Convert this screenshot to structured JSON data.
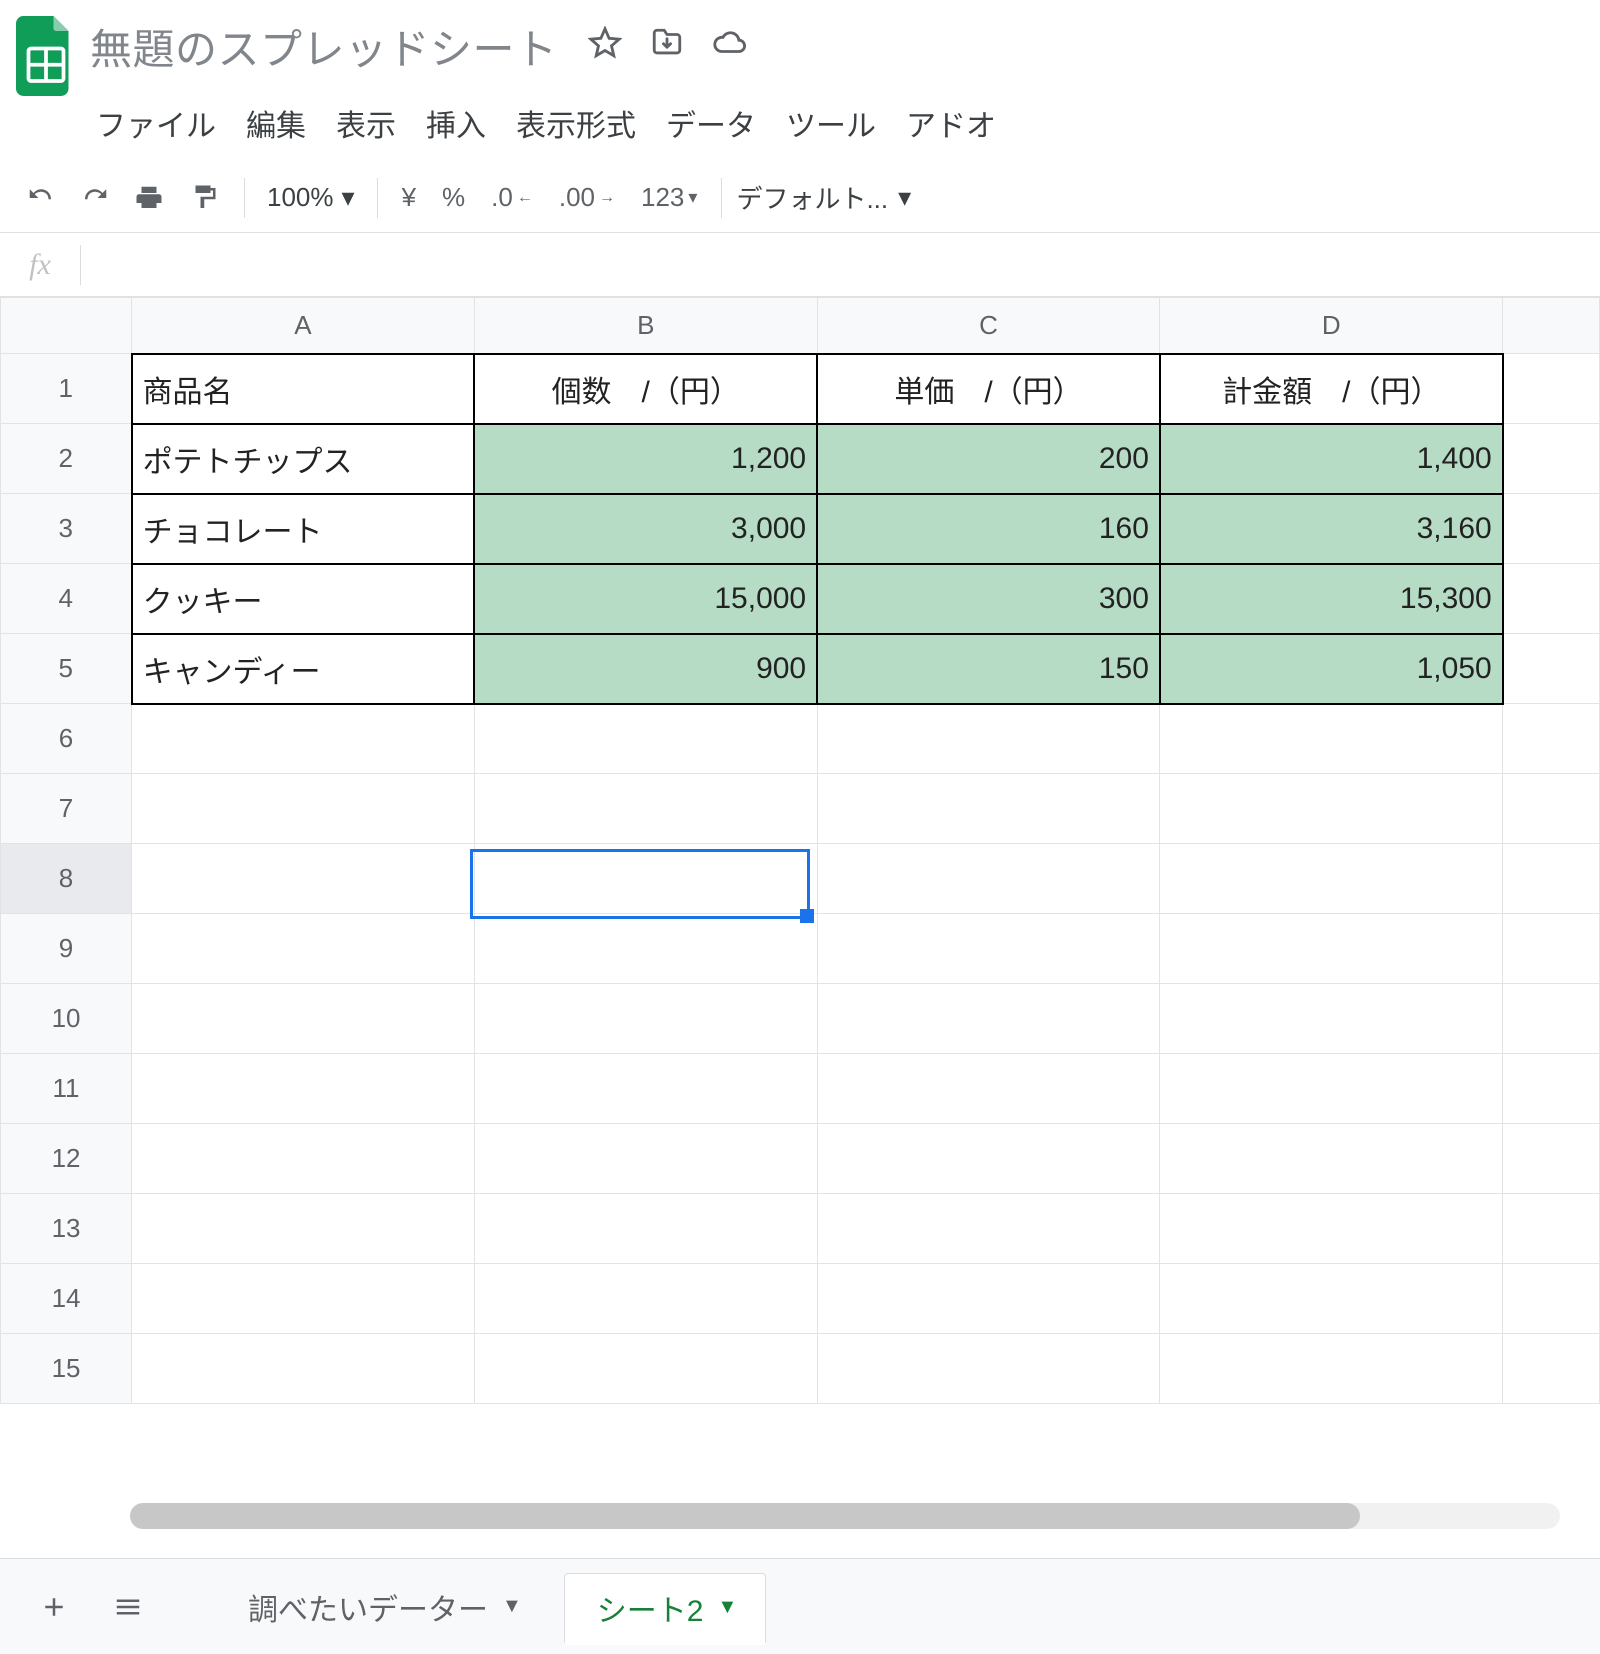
{
  "app": {
    "title": "無題のスプレッドシート",
    "menu": {
      "file": "ファイル",
      "edit": "編集",
      "view": "表示",
      "insert": "挿入",
      "format": "表示形式",
      "data": "データ",
      "tools": "ツール",
      "addons": "アドオ"
    }
  },
  "toolbar": {
    "zoom": "100%",
    "currency": "¥",
    "percent": "%",
    "dec_dec": ".0",
    "dec_inc": ".00",
    "format_num": "123",
    "font": "デフォルト..."
  },
  "fx": {
    "label": "fx",
    "value": ""
  },
  "columns": [
    "A",
    "B",
    "C",
    "D"
  ],
  "rows": [
    "1",
    "2",
    "3",
    "4",
    "5",
    "6",
    "7",
    "8",
    "9",
    "10",
    "11",
    "12",
    "13",
    "14",
    "15"
  ],
  "selected_cell": "B8",
  "sheet": {
    "headers": {
      "A": "商品名",
      "B": "個数　/（円）",
      "C": "単価　/（円）",
      "D": "計金額　/（円）"
    },
    "rows": [
      {
        "name": "ポテトチップス",
        "qty": "1,200",
        "unit": "200",
        "total": "1,400"
      },
      {
        "name": "チョコレート",
        "qty": "3,000",
        "unit": "160",
        "total": "3,160"
      },
      {
        "name": "クッキー",
        "qty": "15,000",
        "unit": "300",
        "total": "15,300"
      },
      {
        "name": "キャンディー",
        "qty": "900",
        "unit": "150",
        "total": "1,050"
      }
    ]
  },
  "tabs": {
    "other": "調べたいデーター",
    "active": "シート2"
  }
}
